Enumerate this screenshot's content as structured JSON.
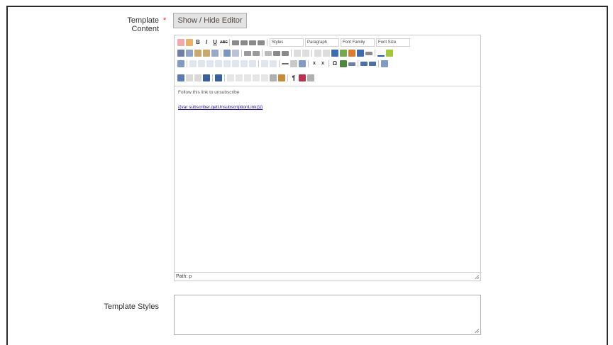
{
  "form": {
    "template_content_label": "Template Content",
    "required_marker": "*",
    "show_hide_button": "Show / Hide Editor",
    "template_styles_label": "Template Styles"
  },
  "editor": {
    "dropdowns": {
      "styles": "Styles",
      "paragraph": "Paragraph",
      "font_family": "Font Family",
      "font_size": "Font Size"
    },
    "toolbar_text": {
      "bold": "B",
      "italic": "I",
      "underline": "U",
      "strike": "ABC"
    },
    "body_text": "Follow this link to unsubscribe",
    "body_link": "{{var subscriber.getUnsubscriptionLink()}}",
    "path": "Path: p"
  },
  "colors": {
    "required": "#e22626",
    "link": "#1a0dab",
    "button_bg": "#e3e3e3"
  }
}
